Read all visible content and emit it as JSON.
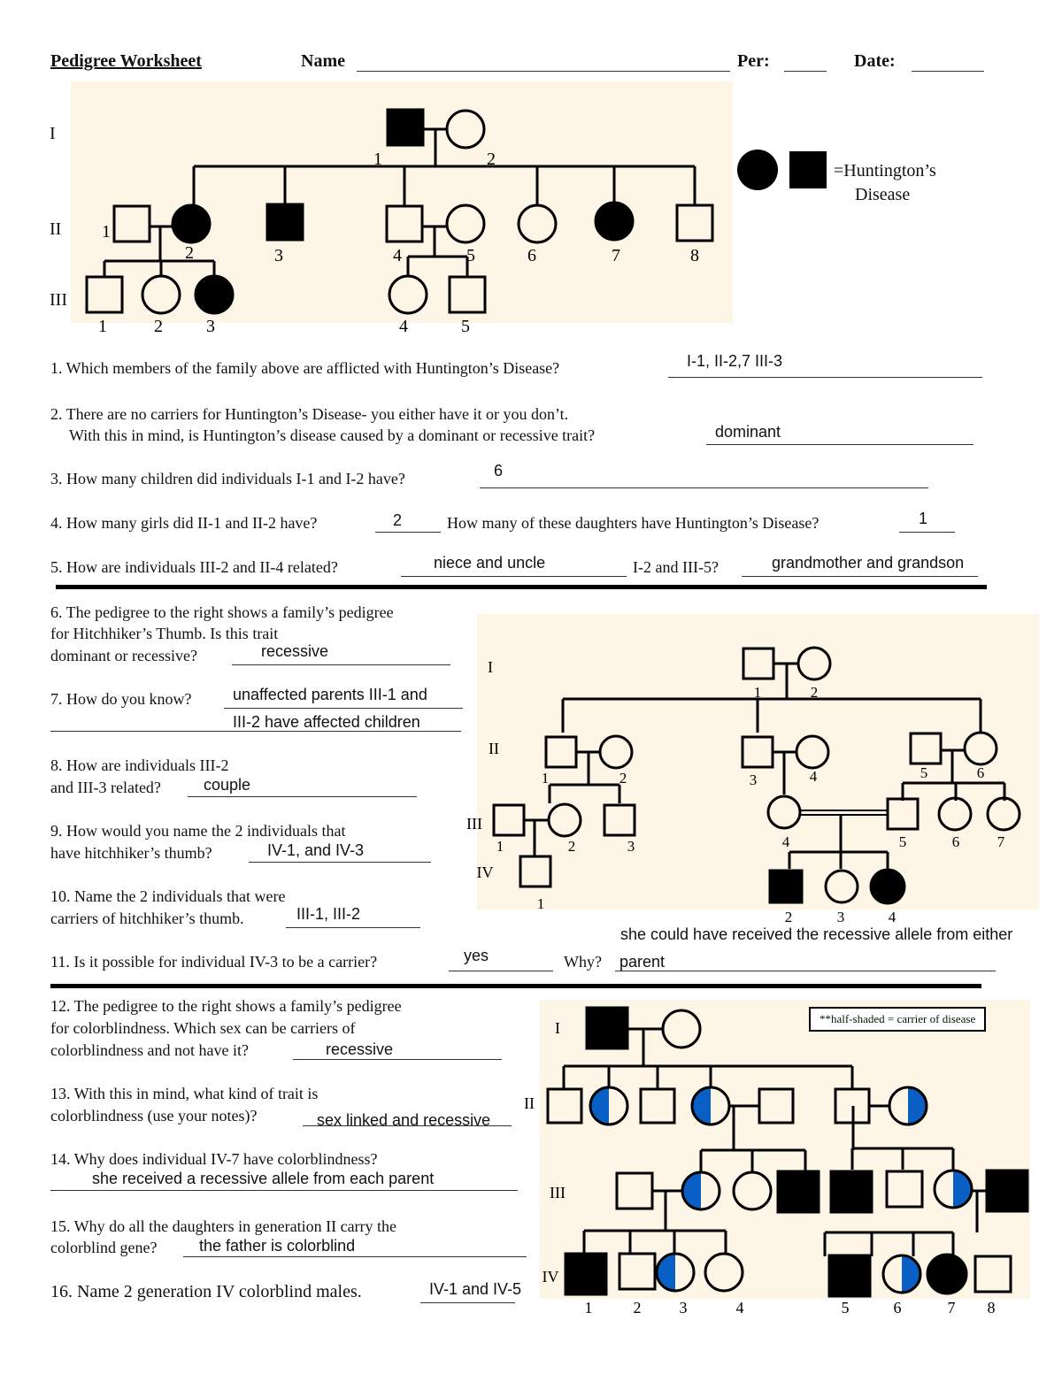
{
  "header": {
    "title": "Pedigree Worksheet",
    "name_label": "Name",
    "per_label": "Per:",
    "date_label": "Date:"
  },
  "pedigree1": {
    "trait": "Huntington's Disease",
    "legend_text_1": "=Huntington’s",
    "legend_text_2": "Disease",
    "generations": [
      "I",
      "II",
      "III"
    ],
    "individuals": [
      {
        "id": "I-1",
        "sex": "male",
        "affected": true,
        "label": "1"
      },
      {
        "id": "I-2",
        "sex": "female",
        "affected": false,
        "label": "2"
      },
      {
        "id": "II-1",
        "sex": "male",
        "affected": false,
        "label": "1"
      },
      {
        "id": "II-2",
        "sex": "female",
        "affected": true,
        "label": "2"
      },
      {
        "id": "II-3",
        "sex": "male",
        "affected": true,
        "label": "3"
      },
      {
        "id": "II-4",
        "sex": "male",
        "affected": false,
        "label": "4"
      },
      {
        "id": "II-5",
        "sex": "female",
        "affected": false,
        "label": "5"
      },
      {
        "id": "II-6",
        "sex": "female",
        "affected": false,
        "label": "6"
      },
      {
        "id": "II-7",
        "sex": "female",
        "affected": true,
        "label": "7"
      },
      {
        "id": "II-8",
        "sex": "male",
        "affected": false,
        "label": "8"
      },
      {
        "id": "III-1",
        "sex": "male",
        "affected": false,
        "label": "1"
      },
      {
        "id": "III-2",
        "sex": "female",
        "affected": false,
        "label": "2"
      },
      {
        "id": "III-3",
        "sex": "female",
        "affected": true,
        "label": "3"
      },
      {
        "id": "III-4",
        "sex": "female",
        "affected": false,
        "label": "4"
      },
      {
        "id": "III-5",
        "sex": "male",
        "affected": false,
        "label": "5"
      }
    ]
  },
  "questions": [
    {
      "n": "1",
      "text": "1. Which members of the family above are afflicted with Huntington’s Disease?",
      "answer": "I-1, II-2,7 III-3"
    },
    {
      "n": "2",
      "text_1": "2. There are no carriers for Huntington’s Disease- you either have it or you don’t.",
      "text_2": "With this in mind, is Huntington’s disease caused by a dominant or recessive trait?",
      "answer": "dominant"
    },
    {
      "n": "3",
      "text": "3. How many children did individuals I-1 and I-2 have?",
      "answer": "6"
    },
    {
      "n": "4",
      "text_a": "4. How many girls did II-1 and II-2 have?",
      "answer_a": "2",
      "text_b": "How many of these daughters have Huntington’s Disease?",
      "answer_b": "1"
    },
    {
      "n": "5",
      "text_a": "5. How are individuals III-2 and II-4 related?",
      "answer_a": "niece and uncle",
      "text_b": "I-2 and III-5?",
      "answer_b": "grandmother and grandson"
    },
    {
      "n": "6",
      "text_1": "6. The pedigree to the right shows a family’s pedigree",
      "text_2": "for Hitchhiker’s Thumb.  Is this trait",
      "text_3": "dominant or recessive?",
      "answer": "recessive"
    },
    {
      "n": "7",
      "text": "7. How do you know?",
      "answer_1": "unaffected parents III-1 and",
      "answer_2": "III-2 have affected children"
    },
    {
      "n": "8",
      "text_1": "8. How are individuals III-2",
      "text_2": "and III-3 related?",
      "answer": "couple"
    },
    {
      "n": "9",
      "text_1": "9. How would you name the 2 individuals that",
      "text_2": "have hitchhiker’s thumb?",
      "answer": "IV-1, and IV-3"
    },
    {
      "n": "10",
      "text_1": "10. Name the 2 individuals that were",
      "text_2": "carriers of hitchhiker’s thumb.",
      "answer": "III-1, III-2"
    },
    {
      "n": "11",
      "text_a": "11. Is it possible for individual IV-3 to be a carrier?",
      "answer_a": "yes",
      "text_b": "Why?",
      "answer_b_1": "she could have received the recessive allele from either",
      "answer_b_2": "parent"
    },
    {
      "n": "12",
      "text_1": "12. The pedigree to the right shows a family’s pedigree",
      "text_2": "for colorblindness.  Which sex can be carriers of",
      "text_3": "colorblindness and not have it?",
      "answer": "recessive"
    },
    {
      "n": "13",
      "text_1": "13. With this in mind, what kind of trait is",
      "text_2": "colorblindness (use your notes)?",
      "answer": "sex linked and recessive"
    },
    {
      "n": "14",
      "text": "14. Why does individual IV-7 have colorblindness?",
      "answer": "she received a recessive allele from each parent"
    },
    {
      "n": "15",
      "text_1": "15. Why do all the daughters in generation II carry the",
      "text_2": "colorblind gene?",
      "answer": "the father is colorblind"
    },
    {
      "n": "16",
      "text": "16. Name 2 generation IV colorblind males.",
      "answer": "IV-1 and IV-5"
    }
  ],
  "pedigree2": {
    "trait": "Hitchhiker's Thumb",
    "generations": [
      "I",
      "II",
      "III",
      "IV"
    ],
    "labels": {
      "I": [
        "1",
        "2"
      ],
      "II": [
        "1",
        "2",
        "3",
        "4",
        "5",
        "6"
      ],
      "III": [
        "1",
        "2",
        "3",
        "4",
        "5",
        "6",
        "7"
      ],
      "IV": [
        "1",
        "2",
        "3",
        "4"
      ]
    },
    "affected": [
      "IV-2",
      "IV-4"
    ]
  },
  "pedigree3": {
    "trait": "Colorblindness",
    "legend": "**half-shaded = carrier of disease",
    "carrier_color": "#0a5fc4",
    "generations": [
      "I",
      "II",
      "III",
      "IV"
    ],
    "labels_IV": [
      "1",
      "2",
      "3",
      "4",
      "5",
      "6",
      "7",
      "8"
    ]
  }
}
